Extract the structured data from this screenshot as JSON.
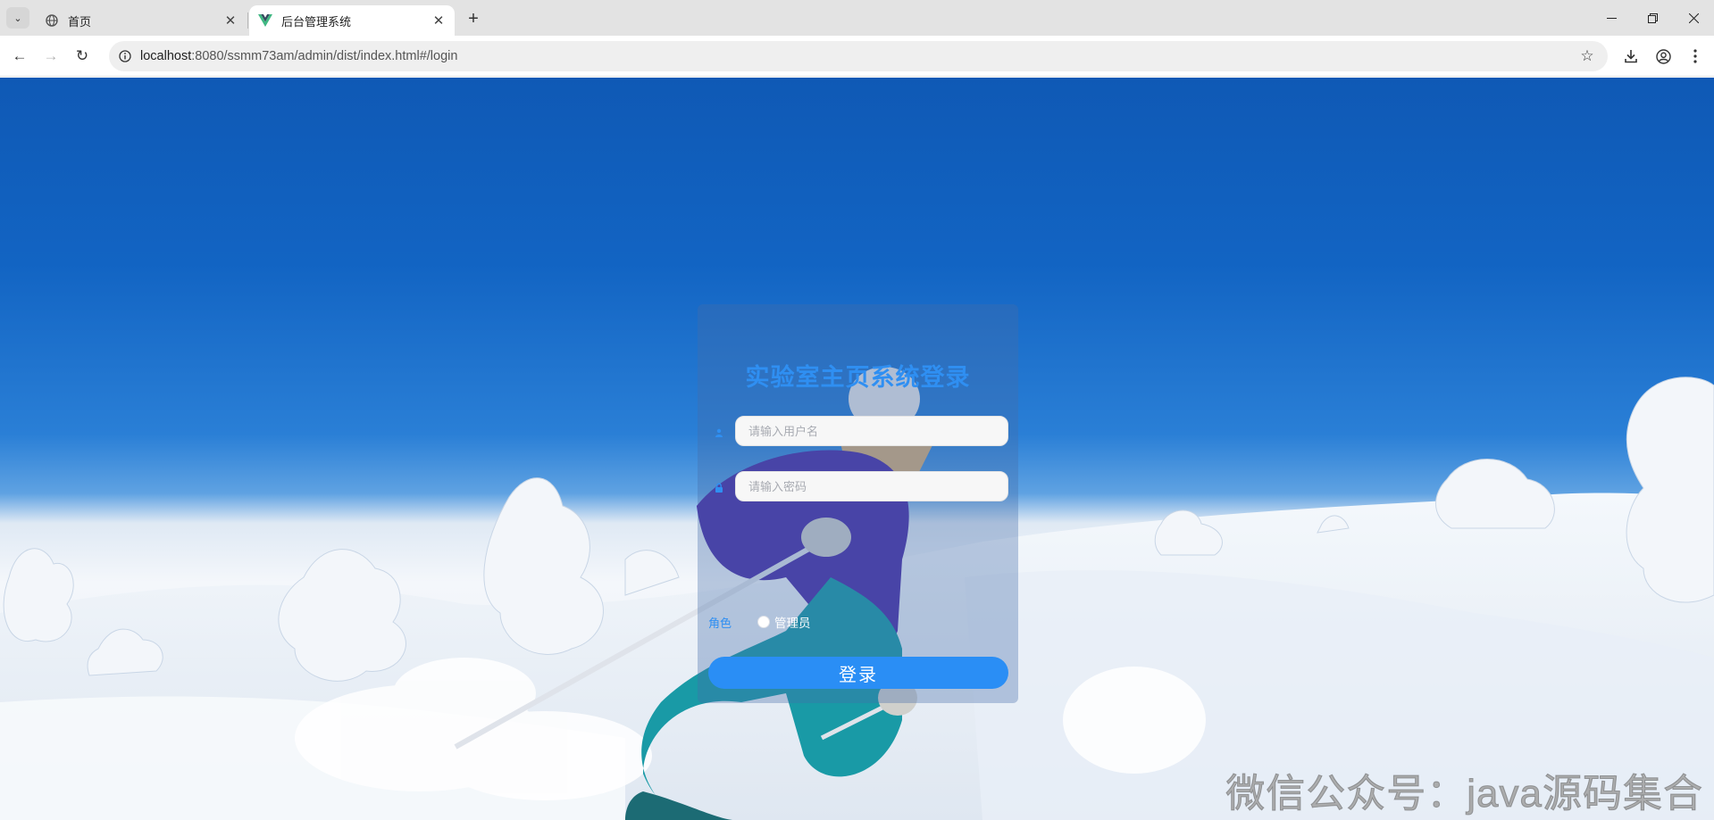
{
  "browser": {
    "tabs": [
      {
        "title": "首页",
        "active": false
      },
      {
        "title": "后台管理系统",
        "active": true
      }
    ],
    "url_host": "localhost",
    "url_rest": ":8080/ssmm73am/admin/dist/index.html#/login"
  },
  "login": {
    "title": "实验室主页系统登录",
    "username_placeholder": "请输入用户名",
    "password_placeholder": "请输入密码",
    "role_label": "角色",
    "role_option": "管理员",
    "submit_label": "登录"
  },
  "watermark": "微信公众号：java源码集合",
  "colors": {
    "accent": "#2f8ff2",
    "button": "#2a8ef5",
    "sky": "#1264c3"
  }
}
